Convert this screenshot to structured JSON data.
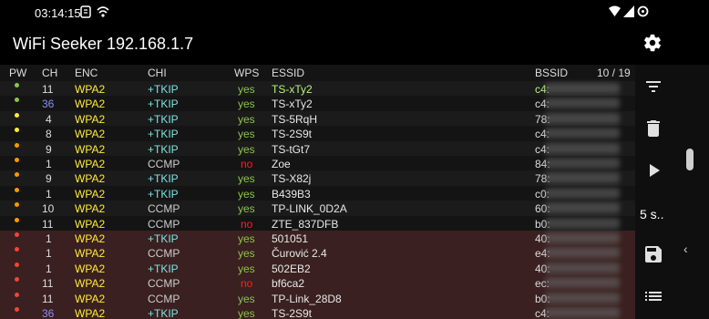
{
  "status": {
    "time": "03:14:15"
  },
  "app": {
    "title": "WiFi Seeker",
    "ip": "192.168.1.7"
  },
  "columns": {
    "pw": "PW",
    "ch": "CH",
    "enc": "ENC",
    "chi": "CHI",
    "wps": "WPS",
    "essid": "ESSID",
    "bssid": "BSSID",
    "count": "10 / 19"
  },
  "side": {
    "interval": "5 s.."
  },
  "colors": {
    "green": "#8bc34a",
    "yellow": "#ffeb3b",
    "orange": "#ff9800",
    "red": "#f44336",
    "enc": "#ffeb3b",
    "tkip": "#7de2e2",
    "ccmp": "#cccccc",
    "wps_yes": "#8bc34a",
    "wps_no": "#ff1f1f",
    "ch_blue": "#8c8cff",
    "selected": "#b7f27a",
    "weak_bg": "#3a2020"
  },
  "rows": [
    {
      "signal": "green",
      "ch": "11",
      "enc": "WPA2",
      "chi": "+TKIP",
      "wps": "yes",
      "essid": "TS-xTy2",
      "bssid": "c4:",
      "selected": true
    },
    {
      "signal": "green",
      "ch": "36",
      "enc": "WPA2",
      "chi": "+TKIP",
      "wps": "yes",
      "essid": "TS-xTy2",
      "bssid": "c4:"
    },
    {
      "signal": "yellow",
      "ch": "4",
      "enc": "WPA2",
      "chi": "+TKIP",
      "wps": "yes",
      "essid": "TS-5RqH",
      "bssid": "78:"
    },
    {
      "signal": "yellow",
      "ch": "8",
      "enc": "WPA2",
      "chi": "+TKIP",
      "wps": "yes",
      "essid": "TS-2S9t",
      "bssid": "c4:"
    },
    {
      "signal": "orange",
      "ch": "9",
      "enc": "WPA2",
      "chi": "+TKIP",
      "wps": "yes",
      "essid": "TS-tGt7",
      "bssid": "c4:"
    },
    {
      "signal": "orange",
      "ch": "1",
      "enc": "WPA2",
      "chi": "CCMP",
      "wps": "no",
      "essid": "Zoe",
      "bssid": "84:"
    },
    {
      "signal": "orange",
      "ch": "9",
      "enc": "WPA2",
      "chi": "+TKIP",
      "wps": "yes",
      "essid": "TS-X82j",
      "bssid": "78:"
    },
    {
      "signal": "orange",
      "ch": "1",
      "enc": "WPA2",
      "chi": "+TKIP",
      "wps": "yes",
      "essid": "B439B3",
      "bssid": "c0:"
    },
    {
      "signal": "orange",
      "ch": "10",
      "enc": "WPA2",
      "chi": "CCMP",
      "wps": "yes",
      "essid": "TP-LINK_0D2A",
      "bssid": "60:"
    },
    {
      "signal": "orange",
      "ch": "11",
      "enc": "WPA2",
      "chi": "CCMP",
      "wps": "no",
      "essid": "ZTE_837DFB",
      "bssid": "b0:"
    },
    {
      "signal": "red",
      "ch": "1",
      "enc": "WPA2",
      "chi": "+TKIP",
      "wps": "yes",
      "essid": "501051",
      "bssid": "40:",
      "weak": true
    },
    {
      "signal": "red",
      "ch": "1",
      "enc": "WPA2",
      "chi": "CCMP",
      "wps": "yes",
      "essid": "Čurović 2.4",
      "bssid": "e4:",
      "weak": true
    },
    {
      "signal": "red",
      "ch": "1",
      "enc": "WPA2",
      "chi": "+TKIP",
      "wps": "yes",
      "essid": "502EB2",
      "bssid": "40:",
      "weak": true
    },
    {
      "signal": "red",
      "ch": "11",
      "enc": "WPA2",
      "chi": "CCMP",
      "wps": "no",
      "essid": "bf6ca2",
      "bssid": "ec:",
      "weak": true
    },
    {
      "signal": "red",
      "ch": "11",
      "enc": "WPA2",
      "chi": "CCMP",
      "wps": "yes",
      "essid": "TP-Link_28D8",
      "bssid": "b0:",
      "weak": true
    },
    {
      "signal": "red",
      "ch": "36",
      "enc": "WPA2",
      "chi": "+TKIP",
      "wps": "yes",
      "essid": "TS-2S9t",
      "bssid": "c4:",
      "weak": true
    }
  ]
}
